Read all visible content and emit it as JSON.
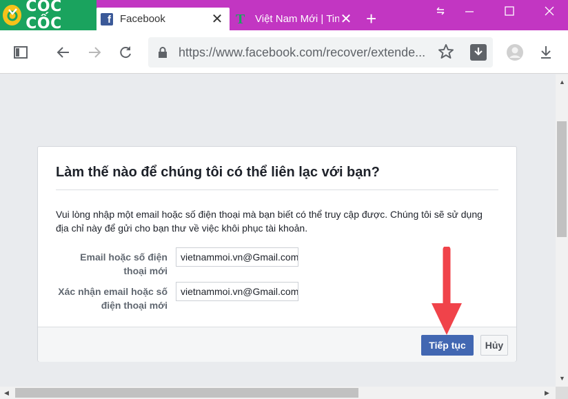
{
  "browser": {
    "brand": "CỐC CỐC",
    "tabs": [
      {
        "title": "Facebook",
        "active": true
      },
      {
        "title": "Việt Nam Mới | Tin",
        "active": false
      }
    ],
    "url": "https://www.facebook.com/recover/extende...",
    "colors": {
      "tabbar": "#c236c2",
      "brand": "#1aa35e"
    }
  },
  "dialog": {
    "title": "Làm thế nào để chúng tôi có thể liên lạc với bạn?",
    "description": "Vui lòng nhập một email hoặc số điện thoại mà bạn biết có thể truy cập được. Chúng tôi sẽ sử dụng địa chỉ này để gửi cho bạn thư về việc khôi phục tài khoản.",
    "fields": [
      {
        "label": "Email hoặc số điện thoại mới",
        "value": "vietnammoi.vn@Gmail.com"
      },
      {
        "label": "Xác nhận email hoặc số điện thoại mới",
        "value": "vietnammoi.vn@Gmail.com"
      }
    ],
    "continue_label": "Tiếp tục",
    "cancel_label": "Hủy",
    "accent": "#4267b2"
  },
  "annotation": {
    "color": "#f0434a",
    "icon": "down-arrow-icon"
  }
}
